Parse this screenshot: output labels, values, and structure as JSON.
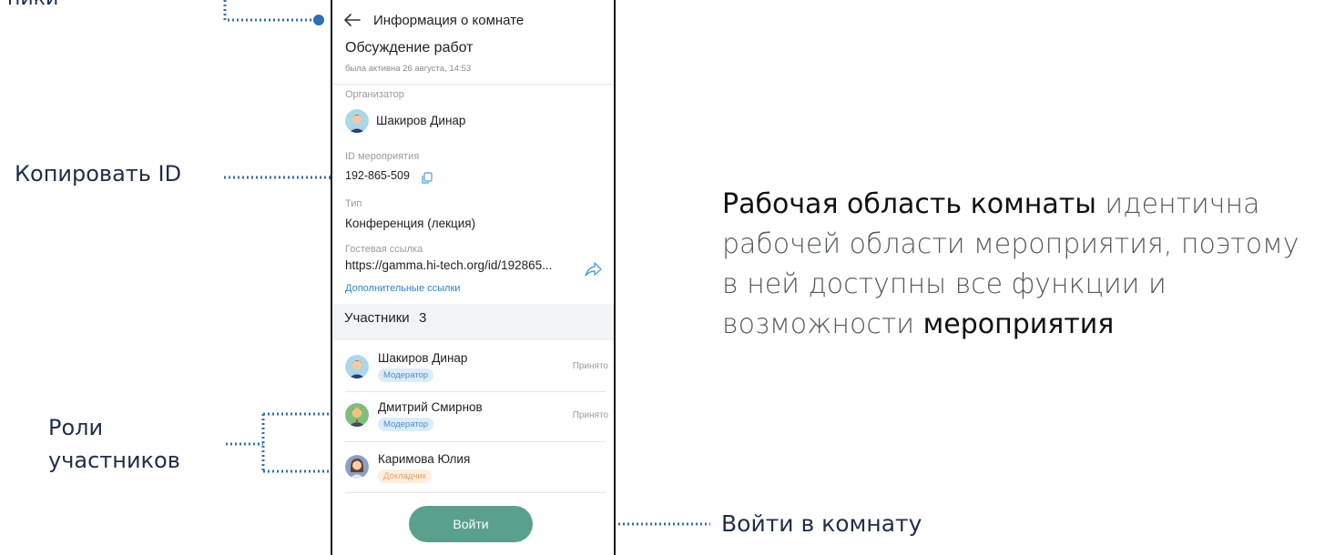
{
  "annotations": {
    "cut_top_left": "ники",
    "copy_id": "Копировать ID",
    "roles_line1": "Роли",
    "roles_line2": "участников",
    "enter_room": "Войти в комнату",
    "desc": {
      "part1_strong": "Рабочая область комнаты",
      "part2": " идентична рабочей области мероприятия, поэтому в ней доступны все функции и возможности ",
      "part3_strong": "мероприятия"
    },
    "accent_color": "#2f6fb5"
  },
  "phone": {
    "header": {
      "back_icon": "arrow-left-icon",
      "title": "Информация о комнате"
    },
    "room": {
      "title": "Обсуждение работ",
      "last_active": "была активна 26 августа, 14:53"
    },
    "organizer": {
      "label": "Организатор",
      "name": "Шакиров Динар"
    },
    "event_id": {
      "label": "ID мероприятия",
      "value": "192-865-509",
      "copy_icon": "copy-icon"
    },
    "type": {
      "label": "Тип",
      "value": "Конференция (лекция)"
    },
    "guest_link": {
      "label": "Гостевая ссылка",
      "value": "https://gamma.hi-tech.org/id/192865...",
      "share_icon": "share-icon",
      "more_links": "Дополнительные ссылки"
    },
    "participants": {
      "label": "Участники",
      "count": "3",
      "items": [
        {
          "name": "Шакиров Динар",
          "role": "Модератор",
          "status": "Принято"
        },
        {
          "name": "Дмитрий Смирнов",
          "role": "Модератор",
          "status": "Принято"
        },
        {
          "name": "Каримова Юлия",
          "role": "Докладчик",
          "status": ""
        }
      ]
    },
    "enter_button": "Войти",
    "colors": {
      "button": "#5aa08e",
      "moderator_badge_bg": "#dcecfa",
      "speaker_badge_bg": "#fdeede",
      "link": "#2b83c9"
    }
  }
}
